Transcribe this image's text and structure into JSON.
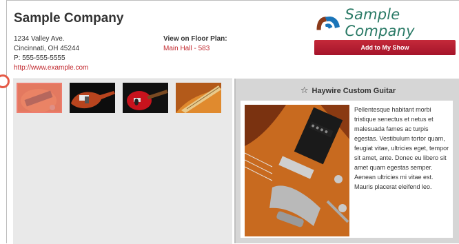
{
  "company": {
    "name": "Sample Company",
    "address_line1": "1234 Valley Ave.",
    "address_line2": "Cincinnati, OH 45244",
    "phone": "P: 555-555-5555",
    "website": "http://www.example.com"
  },
  "floor_plan": {
    "heading": "View on Floor Plan:",
    "link": "Main Hall - 583"
  },
  "logo": {
    "text": "Sample Company",
    "colors": {
      "brown": "#8b3a1a",
      "blue": "#1a74b8",
      "text": "#2a7a66"
    }
  },
  "actions": {
    "add_to_show": "Add to My Show"
  },
  "gallery": {
    "thumbnails": [
      {
        "icon": "guitar-closeup-photo",
        "selected": true
      },
      {
        "icon": "black-guitar-photo",
        "selected": false
      },
      {
        "icon": "red-guitar-photo",
        "selected": false
      },
      {
        "icon": "guitar-fretboard-photo",
        "selected": false
      }
    ],
    "selected_overlay_color": "#ee7d6f"
  },
  "detail": {
    "star_icon": "☆",
    "title": "Haywire Custom Guitar",
    "description": "Pellentesque habitant morbi tristique senectus et netus et malesuada fames ac turpis egestas. Vestibulum tortor quam, feugiat vitae, ultricies eget, tempor sit amet, ante. Donec eu libero sit amet quam egestas semper. Aenean ultricies mi vitae est. Mauris placerat eleifend leo."
  },
  "accent_color": "#c1272d"
}
